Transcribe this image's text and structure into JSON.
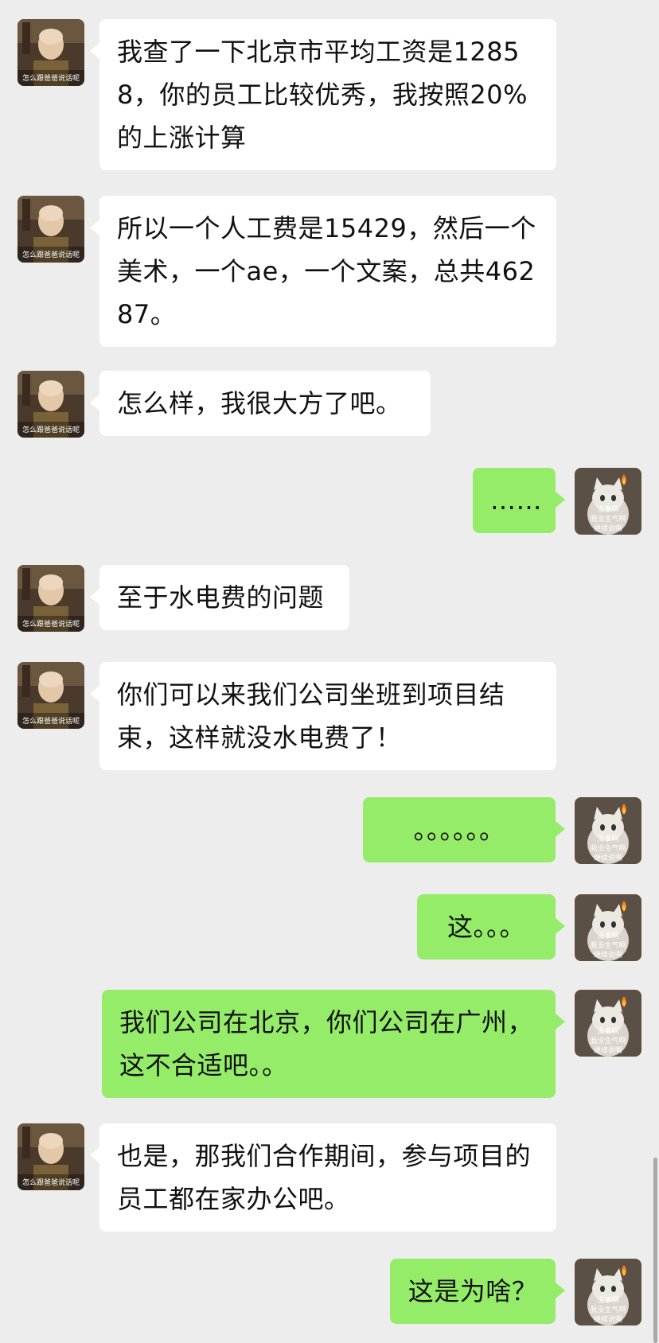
{
  "avatars": {
    "other": {
      "icon": "bald-man-avatar-icon",
      "caption": "怎么跟爸爸说话呢"
    },
    "self": {
      "icon": "cat-avatar-icon",
      "caption_lines": [
        "没事啊",
        "我没生气啊",
        "继续说啊"
      ]
    }
  },
  "messages": [
    {
      "side": "in",
      "text": "我查了一下北京市平均工资是12858，你的员工比较优秀，我按照20%的上涨计算"
    },
    {
      "side": "in",
      "text": "所以一个人工费是15429，然后一个美术，一个ae，一个文案，总共46287。"
    },
    {
      "side": "in",
      "text": "怎么样，我很大方了吧。"
    },
    {
      "side": "out",
      "text": "……"
    },
    {
      "side": "in",
      "text": "至于水电费的问题"
    },
    {
      "side": "in",
      "text": "你们可以来我们公司坐班到项目结束，这样就没水电费了！"
    },
    {
      "side": "out",
      "text": "。。。。。。"
    },
    {
      "side": "out",
      "text": "这。。。"
    },
    {
      "side": "out",
      "text": "我们公司在北京，你们公司在广州，这不合适吧。。"
    },
    {
      "side": "in",
      "text": "也是，那我们合作期间，参与项目的员工都在家办公吧。"
    },
    {
      "side": "out",
      "text": "这是为啥？"
    }
  ]
}
